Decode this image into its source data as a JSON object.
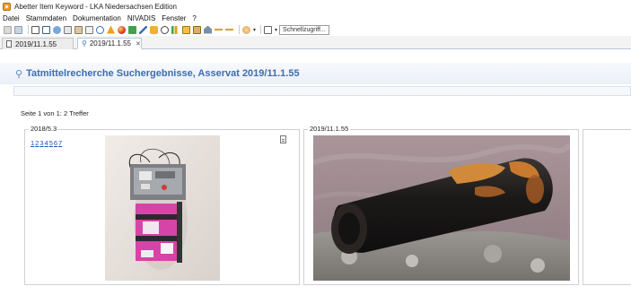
{
  "window": {
    "title": "Abetter Item Keyword - LKA Niedersachsen Edition"
  },
  "menu": [
    "Datei",
    "Stammdaten",
    "Dokumentation",
    "NIVADIS",
    "Fenster",
    "?"
  ],
  "toolbar": {
    "quick_access_label": "Schnellzugriff...",
    "icons": [
      "home-icon",
      "save-icon",
      "edit-icon",
      "mail-icon",
      "people-icon",
      "copy-icon",
      "paste-icon",
      "list-icon",
      "search-icon",
      "warning-icon",
      "globe-icon",
      "flag-icon",
      "pen-icon",
      "tag-icon",
      "link-icon",
      "chart-icon",
      "stamp-icon",
      "case-icon",
      "house-icon",
      "key-icon",
      "key-icon",
      "globe-icon",
      "document-icon"
    ],
    "colors": {
      "accent": "#3d6eae",
      "warning": "#f0a020"
    }
  },
  "tabs": [
    {
      "label": "2019/11.1.55",
      "active": false
    },
    {
      "label": "2019/11.1.55",
      "active": true
    }
  ],
  "header": {
    "title": "Tatmittelrecherche Suchergebnisse, Asservat 2019/11.1.55"
  },
  "results": {
    "paging_text": "Seite 1 von 1: 2 Treffer",
    "items": [
      {
        "id": "2018/5.3",
        "page_links": [
          "1",
          "2",
          "3",
          "4",
          "5",
          "6",
          "7"
        ]
      },
      {
        "id": "2019/11.1.55"
      }
    ]
  }
}
